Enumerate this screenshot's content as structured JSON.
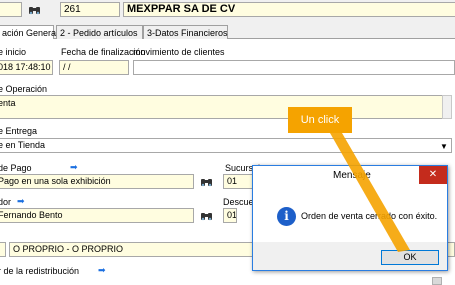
{
  "header": {
    "code": "261",
    "client_name": "MEXPPAR SA DE CV"
  },
  "tabs": [
    {
      "label": "ación General"
    },
    {
      "label": "2 - Pedido artículos"
    },
    {
      "label": "3-Datos Financieros"
    }
  ],
  "general": {
    "start_label": "e inicio",
    "start_value": "018 17:48:10",
    "end_label": "Fecha de finalización",
    "end_value": " / /",
    "client_move_label": "movimiento de clientes",
    "operation_label": "e Operación",
    "operation_value": "enta",
    "delivery_label": "e Entrega",
    "delivery_value": "e en Tienda",
    "payment_label": "de Pago",
    "payment_value": "Pago en una sola exhibición",
    "branch_label": "Sucursal",
    "branch_value": "01",
    "seller_label": "dor",
    "seller_value": "Fernando Bento",
    "discount_label": "Descue",
    "discount_value": "01",
    "owner_value": "O PROPRIO - O PROPRIO",
    "redistribution_label": "r de la redistribución"
  },
  "dialog": {
    "title": "Mensaje",
    "message": "Orden de venta cerrado con éxito.",
    "ok_label": "OK",
    "close_symbol": "✕",
    "info_icon_char": "i"
  },
  "annotation": {
    "label": "Un click",
    "color": "#f5a300"
  }
}
